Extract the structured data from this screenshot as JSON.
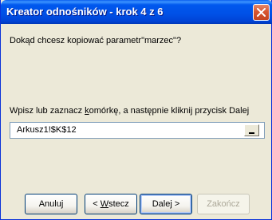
{
  "window": {
    "title": "Kreator odnośników - krok 4 z 6"
  },
  "prompt": {
    "question": "Dokąd chcesz kopiować parametr\"marzec\"?"
  },
  "instruction": {
    "prefix": "Wpisz lub zaznacz ",
    "ul": "k",
    "suffix": "omórkę, a następnie kliknij przycisk Dalej"
  },
  "reference_input": {
    "value": "Arkusz1!$K$12"
  },
  "buttons": {
    "cancel": {
      "label": "Anuluj"
    },
    "back": {
      "prefix": "< ",
      "ul": "W",
      "suffix": "stecz"
    },
    "next": {
      "label": "Dalej >"
    },
    "finish": {
      "label": "Zakończ"
    }
  },
  "icons": {
    "close": "close-icon",
    "collapse": "collapse-dialog-icon"
  },
  "colors": {
    "titlebar": "#0054E3",
    "face": "#ECE9D8",
    "close": "#D8552F"
  }
}
